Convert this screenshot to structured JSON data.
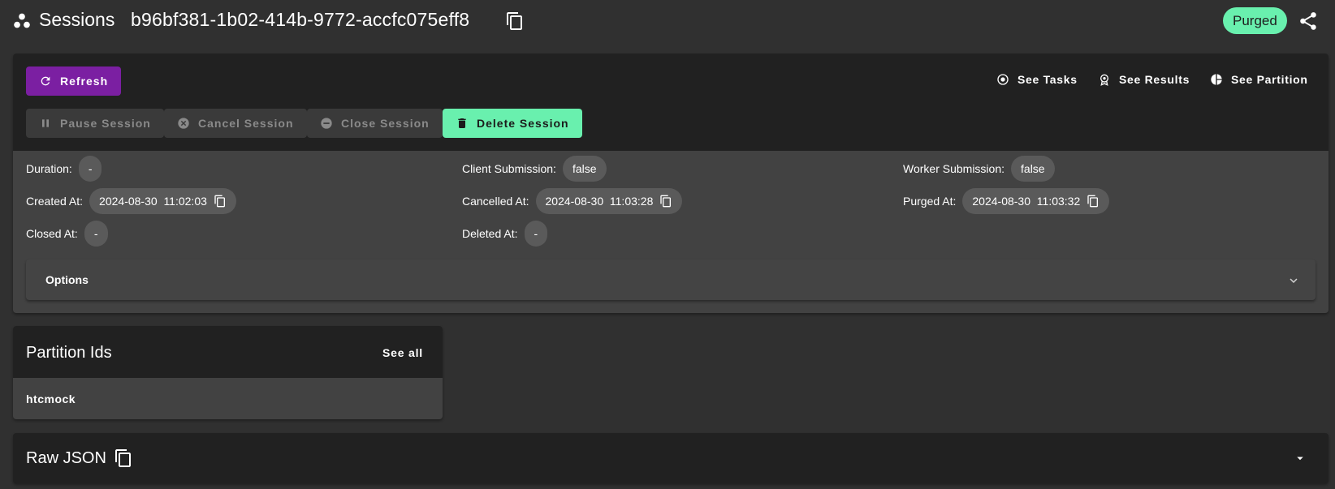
{
  "header": {
    "title": "Sessions",
    "session_id": "b96bf381-1b02-414b-9772-accfc075eff8",
    "status": "Purged",
    "icons": {
      "logo": "sessions-icon",
      "copy": "copy-icon",
      "share": "share-icon"
    },
    "colors": {
      "status_bg": "#69f0ae"
    }
  },
  "actions": {
    "refresh_label": "Refresh",
    "pause_label": "Pause Session",
    "cancel_label": "Cancel Session",
    "close_label": "Close Session",
    "delete_label": "Delete Session",
    "see_tasks_label": "See Tasks",
    "see_results_label": "See Results",
    "see_partition_label": "See Partition",
    "colors": {
      "refresh_bg": "#7b1fa2",
      "delete_bg": "#69f0ae"
    }
  },
  "details": {
    "duration": {
      "label": "Duration:",
      "value": "-"
    },
    "client_submission": {
      "label": "Client Submission:",
      "value": "false"
    },
    "worker_submission": {
      "label": "Worker Submission:",
      "value": "false"
    },
    "created_at": {
      "label": "Created At:",
      "value": "2024-08-30  11:02:03"
    },
    "cancelled_at": {
      "label": "Cancelled At:",
      "value": "2024-08-30  11:03:28"
    },
    "purged_at": {
      "label": "Purged At:",
      "value": "2024-08-30  11:03:32"
    },
    "closed_at": {
      "label": "Closed At:",
      "value": "-"
    },
    "deleted_at": {
      "label": "Deleted At:",
      "value": "-"
    }
  },
  "options": {
    "label": "Options"
  },
  "partitions": {
    "title": "Partition Ids",
    "see_all_label": "See all",
    "items": [
      "htcmock"
    ]
  },
  "raw_json": {
    "title": "Raw JSON"
  }
}
